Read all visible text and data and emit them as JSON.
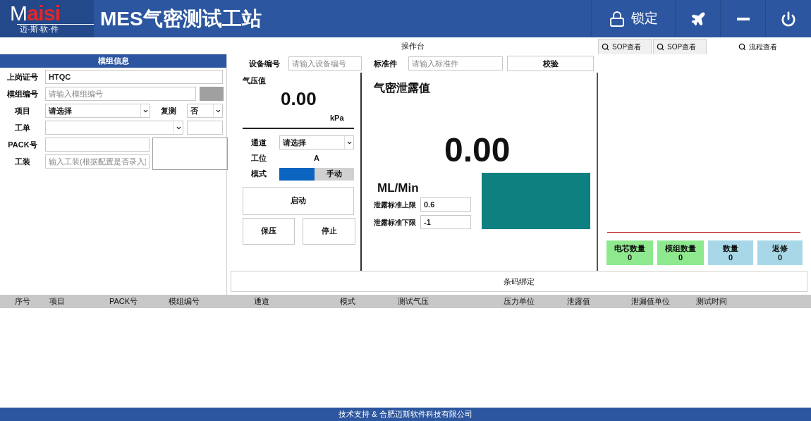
{
  "header": {
    "logo": {
      "lead": "M",
      "rest": "aisi",
      "tagline": "迈·斯·软·件"
    },
    "title": "MES气密测试工站",
    "lock_label": "锁定"
  },
  "console_title": "操作台",
  "tabs": [
    {
      "label": "SOP查看",
      "selected": false
    },
    {
      "label": "SOP查看",
      "selected": false
    },
    {
      "label": "流程查看",
      "selected": true
    }
  ],
  "module_info": {
    "title": "模组信息",
    "fields": [
      {
        "kind": "text",
        "label": "上岗证号",
        "value": "HTQC"
      },
      {
        "kind": "text_swatch",
        "label": "模组编号",
        "placeholder": "请输入模组编号"
      },
      {
        "kind": "select_retest",
        "label": "项目",
        "value": "请选择",
        "retest_label": "复测",
        "retest_value": "否"
      },
      {
        "kind": "select_box",
        "label": "工单"
      },
      {
        "kind": "text",
        "label": "PACK号"
      },
      {
        "kind": "text",
        "label": "工装",
        "placeholder": "输入工装(根据配置是否录入)"
      }
    ]
  },
  "device": {
    "label": "设备编号",
    "placeholder": "请输入设备编号"
  },
  "standard": {
    "label": "标准件",
    "placeholder": "请输入标准件"
  },
  "verify_button": "校验",
  "pressure": {
    "label": "气压值",
    "value": "0.00",
    "unit": "kPa"
  },
  "channel": {
    "label": "通道",
    "value": "请选择"
  },
  "station": {
    "label": "工位",
    "value": "A"
  },
  "mode": {
    "label": "模式",
    "switch_label": "手动",
    "on": true
  },
  "buttons": {
    "start": "启动",
    "hold": "保压",
    "stop": "停止"
  },
  "leak": {
    "title": "气密泄露值",
    "value": "0.00",
    "unit": "ML/Min",
    "upper_label": "泄露标准上限",
    "upper_value": "0.6",
    "lower_label": "泄露标准下限",
    "lower_value": "-1",
    "color": "#0e8080"
  },
  "counters": [
    {
      "label": "电芯数量",
      "value": "0",
      "color": "#8ee88e"
    },
    {
      "label": "模组数量",
      "value": "0",
      "color": "#8ee88e"
    },
    {
      "label": "数量",
      "value": "0",
      "color": "#a8d8e8"
    },
    {
      "label": "返修",
      "value": "0",
      "color": "#a8d8e8"
    }
  ],
  "barcode_bind": "条码绑定",
  "table": {
    "columns": [
      "序号",
      "项目",
      "PACK号",
      "模组编号",
      "通道",
      "模式",
      "测试气压",
      "压力单位",
      "泄露值",
      "泄漏值单位",
      "测试时间"
    ]
  },
  "footer": "技术支持 & 合肥迈斯软件科技有限公司"
}
